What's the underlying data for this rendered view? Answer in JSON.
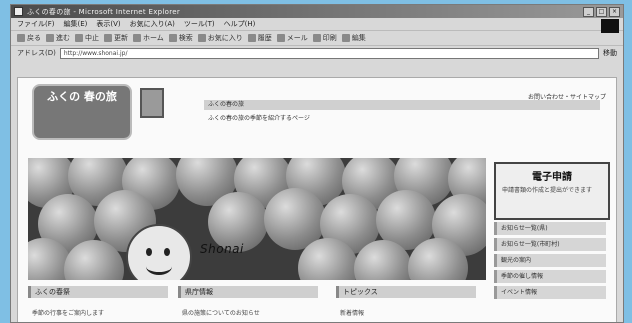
{
  "window": {
    "title": "ふくの春の旅 - Microsoft Internet Explorer",
    "controls": [
      "_",
      "□",
      "×"
    ]
  },
  "menubar": {
    "items": [
      "ファイル(F)",
      "編集(E)",
      "表示(V)",
      "お気に入り(A)",
      "ツール(T)",
      "ヘルプ(H)"
    ]
  },
  "toolbar": {
    "items": [
      "戻る",
      "進む",
      "中止",
      "更新",
      "ホーム",
      "検索",
      "お気に入り",
      "履歴",
      "メール",
      "印刷",
      "編集"
    ]
  },
  "addressbar": {
    "label": "アドレス(D)",
    "url": "http://www.shonai.jp/",
    "go_label": "移動"
  },
  "page": {
    "logo_text": "ふくの 春の旅",
    "sitemap_link": "お問い合わせ・サイトマップ",
    "header_lines": [
      "ふくの春の旅",
      "ふくの春の旅の季節を紹介するページ"
    ],
    "hero_caption": "Shonai",
    "side_box": {
      "title": "電子申請",
      "text": "申請書類の作成と提出ができます"
    },
    "side_links": [
      "お知らせ一覧(県)",
      "お知らせ一覧(市町村)",
      "観光の案内",
      "季節の催し情報",
      "イベント情報"
    ],
    "sections": [
      {
        "heading": "ふくの春祭",
        "text": "季節の行事をご案内します"
      },
      {
        "heading": "県庁情報",
        "text": "県の施策についてのお知らせ"
      },
      {
        "heading": "トピックス",
        "text": "新着情報"
      }
    ]
  }
}
